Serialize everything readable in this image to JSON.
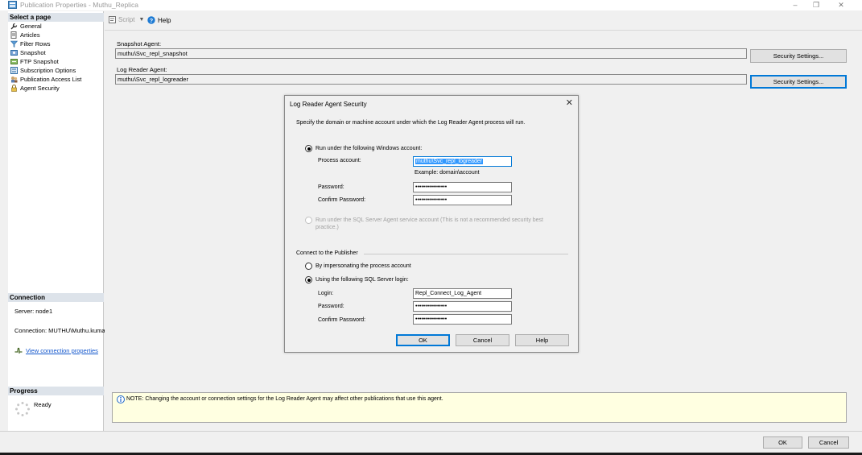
{
  "window": {
    "title": "Publication Properties - Muthu_Replica",
    "minimize": "–",
    "restore": "❐",
    "close": "✕"
  },
  "leftpane": {
    "select_page_header": "Select a page",
    "pages": [
      {
        "label": "General",
        "icon": "wrench-icon"
      },
      {
        "label": "Articles",
        "icon": "articles-icon"
      },
      {
        "label": "Filter Rows",
        "icon": "filter-icon"
      },
      {
        "label": "Snapshot",
        "icon": "snapshot-icon"
      },
      {
        "label": "FTP Snapshot",
        "icon": "ftp-icon"
      },
      {
        "label": "Subscription Options",
        "icon": "options-icon"
      },
      {
        "label": "Publication Access List",
        "icon": "access-list-icon"
      },
      {
        "label": "Agent Security",
        "icon": "lock-icon"
      }
    ],
    "connection_header": "Connection",
    "server": "Server: node1",
    "connection": "Connection: MUTHU\\Muthu.kuma",
    "view_connection": "View connection properties",
    "progress_header": "Progress",
    "progress_status": "Ready"
  },
  "toolbar": {
    "script_label": "Script",
    "help_label": "Help"
  },
  "main": {
    "snapshot_agent_label": "Snapshot Agent:",
    "snapshot_agent_value": "muthu\\Svc_repl_snapshot",
    "log_reader_agent_label": "Log Reader Agent:",
    "log_reader_agent_value": "muthu\\Svc_repl_logreader",
    "security_settings_label": "Security Settings...",
    "notice": "NOTE: Changing the account or connection settings for the Log Reader Agent may affect other publications that use this agent."
  },
  "footer": {
    "ok_label": "OK",
    "cancel_label": "Cancel"
  },
  "dialog": {
    "title": "Log Reader Agent Security",
    "close": "✕",
    "intro": "Specify the domain or machine account under which the Log Reader Agent process will run.",
    "run_windows_label": "Run under the following Windows account:",
    "process_account_label": "Process account:",
    "process_account_value": "muthu\\Svc_repl_logreader",
    "example": "Example: domain\\account",
    "password_label": "Password:",
    "password_value": "••••••••••••••••",
    "confirm_password_label": "Confirm Password:",
    "confirm_password_value": "••••••••••••••••",
    "run_sql_agent_line1": "Run under the SQL Server Agent service account (This is not a recommended security best",
    "run_sql_agent_line2": "practice.)",
    "connect_publisher_label": "Connect to the Publisher",
    "impersonate_label": "By impersonating the process account",
    "sql_login_option_label": "Using the following SQL Server login:",
    "login_label": "Login:",
    "login_value": "Repl_Connect_Log_Agent",
    "login_password_label": "Password:",
    "login_password_value": "••••••••••••••••",
    "login_confirm_label": "Confirm Password:",
    "login_confirm_value": "••••••••••••••••",
    "ok_label": "OK",
    "cancel_label": "Cancel",
    "help_label": "Help"
  }
}
